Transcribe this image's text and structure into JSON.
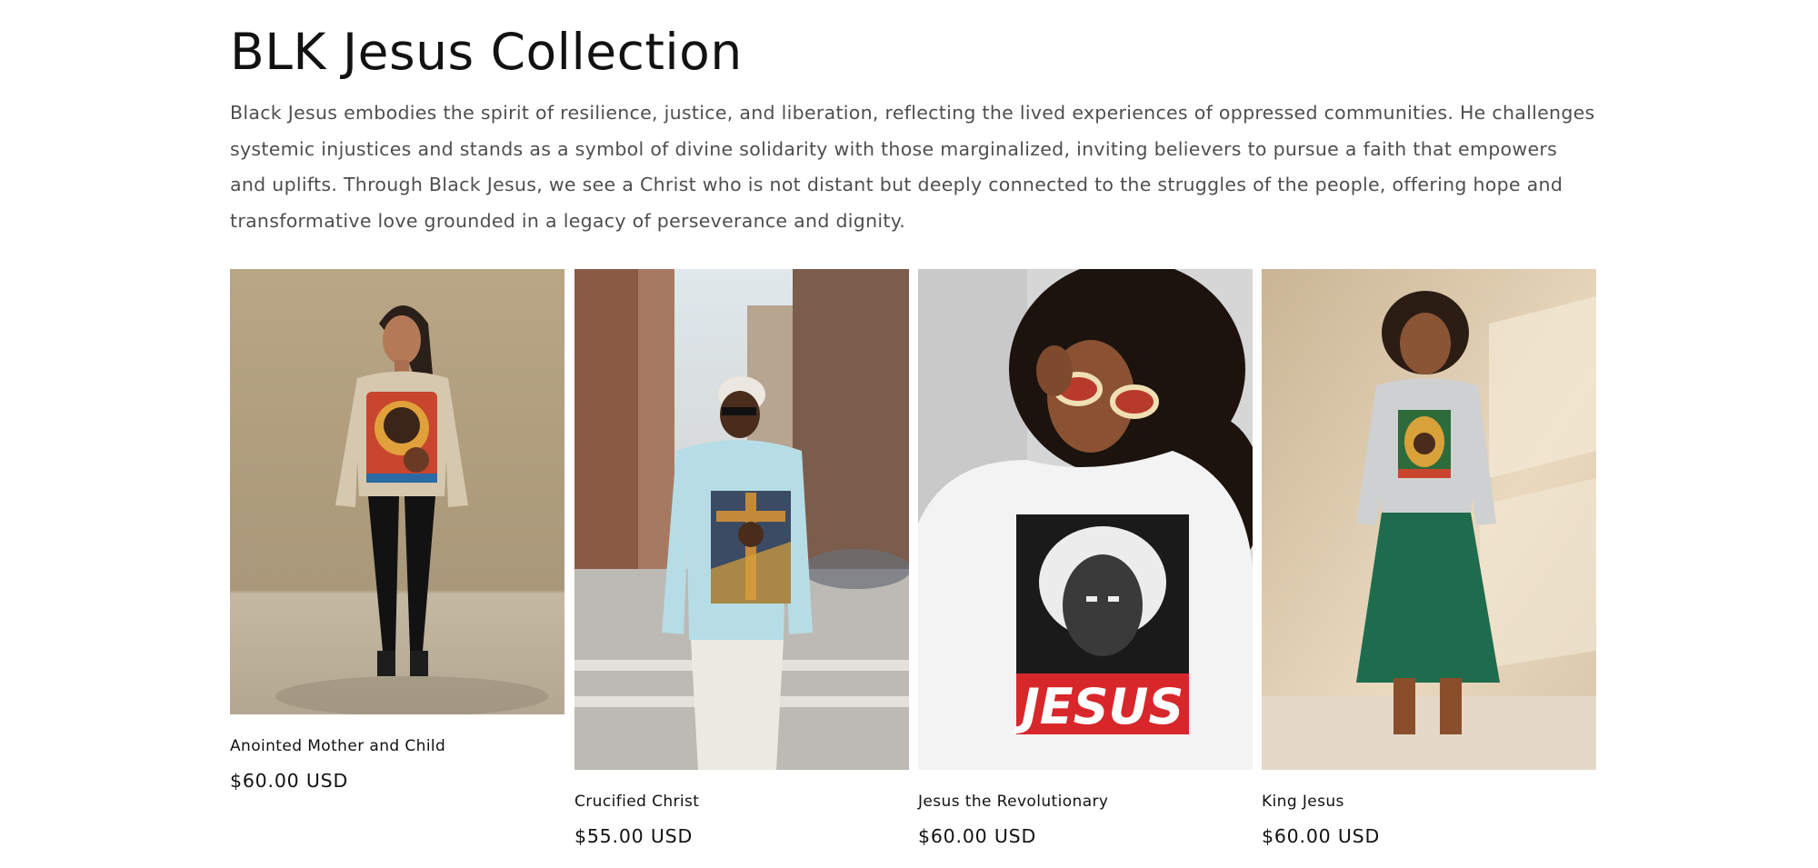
{
  "collection": {
    "title": "BLK Jesus Collection",
    "description": "Black Jesus embodies the spirit of resilience, justice, and liberation, reflecting the lived experiences of oppressed communities. He challenges systemic injustices and stands as a symbol of divine solidarity with those marginalized, inviting believers to pursue a faith that empowers and uplifts. Through Black Jesus, we see a Christ who is not distant but deeply connected to the struggles of the people, offering hope and transformative love grounded in a legacy of perseverance and dignity."
  },
  "products": [
    {
      "title": "Anointed Mother and Child",
      "price": "$60.00 USD",
      "image_alt": "Woman wearing a beige sweatshirt with a colorful mother and child print",
      "colors": {
        "background": "#b9a98b",
        "garment": "#d9cbb2",
        "accent": "#c8452e"
      }
    },
    {
      "title": "Crucified Christ",
      "price": "$55.00 USD",
      "image_alt": "Man in a light blue sweatshirt with a crucifixion print on a city street",
      "colors": {
        "background": "#8a8e92",
        "garment": "#b9dfe6",
        "accent": "#d9a13a"
      }
    },
    {
      "title": "Jesus the Revolutionary",
      "price": "$60.00 USD",
      "image_alt": "Woman in a white sweatshirt with a black and white Jesus portrait and red JESUS banner",
      "print_text": "JESUS",
      "colors": {
        "background": "#d8d8d8",
        "garment": "#f2f2f2",
        "accent": "#d8272b"
      }
    },
    {
      "title": "King Jesus",
      "price": "$60.00 USD",
      "image_alt": "Woman in a grey sweatshirt and green skirt with a colorful Jesus print",
      "colors": {
        "background": "#e3d5bd",
        "garment": "#cfd0d2",
        "accent": "#1f6b4d"
      }
    }
  ]
}
